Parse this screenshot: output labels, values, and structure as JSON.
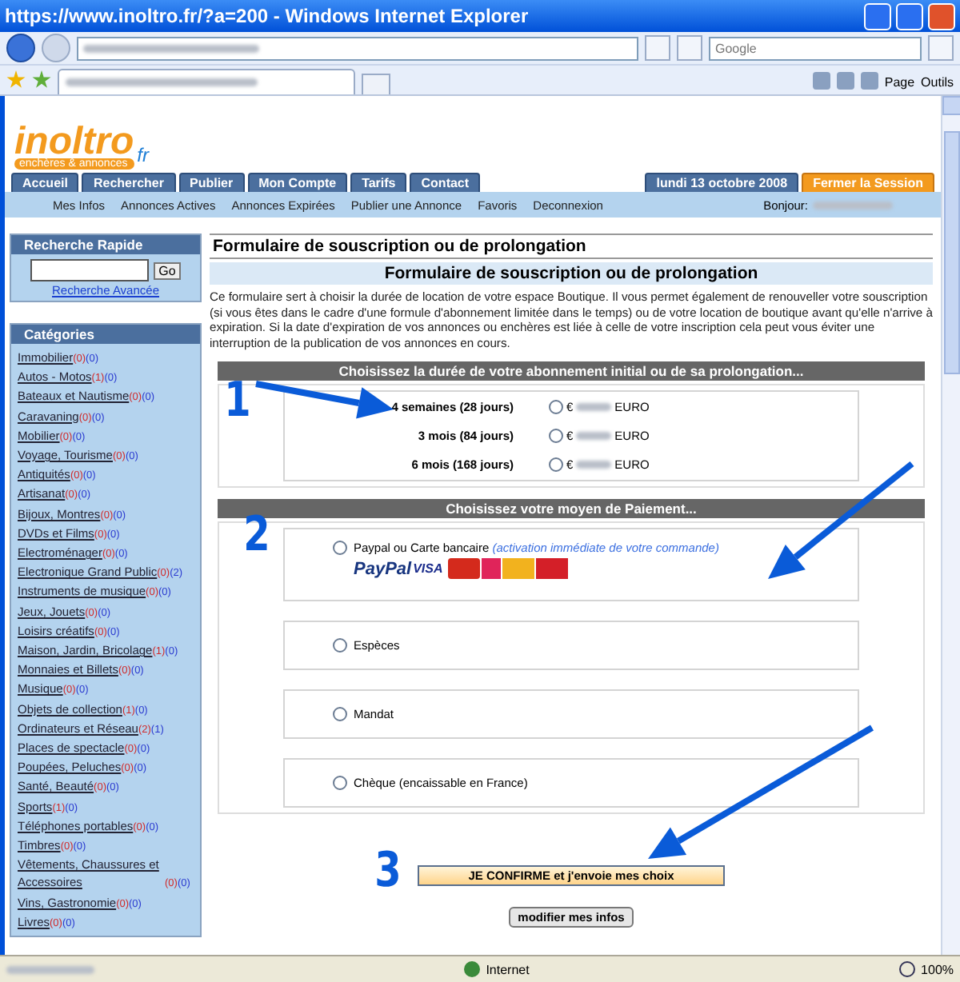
{
  "browser": {
    "title": "https://www.inoltro.fr/?a=200 - Windows Internet Explorer",
    "search_placeholder": "Google",
    "toolbar_menus": [
      "Page",
      "Outils"
    ],
    "status_zone": "Internet",
    "zoom": "100%"
  },
  "logo": {
    "name": "inoltro",
    "tagline": "enchères & annonces",
    "suffix": "fr"
  },
  "nav": {
    "tabs": [
      {
        "label": "Accueil"
      },
      {
        "label": "Rechercher"
      },
      {
        "label": "Publier"
      },
      {
        "label": "Mon Compte"
      },
      {
        "label": "Tarifs"
      },
      {
        "label": "Contact"
      }
    ],
    "date": "lundi 13 octobre 2008",
    "logout": "Fermer la Session"
  },
  "subnav": {
    "links": [
      "Mes Infos",
      "Annonces Actives",
      "Annonces Expirées",
      "Publier une Annonce",
      "Favoris",
      "Deconnexion"
    ],
    "greeting": "Bonjour:"
  },
  "quick_search": {
    "title": "Recherche Rapide",
    "button": "Go",
    "advanced_link": "Recherche Avancée"
  },
  "categories": {
    "title": "Catégories",
    "items": [
      {
        "name": "Immobilier",
        "count_1": "(0)",
        "count_2": "(0)"
      },
      {
        "name": "Autos - Motos",
        "count_1": "(1)",
        "count_2": "(0)"
      },
      {
        "name": "Bateaux et Nautisme",
        "count_1": "(0)",
        "count_2": "(0)"
      },
      {
        "name": "Caravaning",
        "count_1": "(0)",
        "count_2": "(0)"
      },
      {
        "name": "Mobilier",
        "count_1": "(0)",
        "count_2": "(0)"
      },
      {
        "name": "Voyage, Tourisme",
        "count_1": "(0)",
        "count_2": "(0)"
      },
      {
        "name": "Antiquités",
        "count_1": "(0)",
        "count_2": "(0)"
      },
      {
        "name": "Artisanat",
        "count_1": "(0)",
        "count_2": "(0)"
      },
      {
        "name": "Bijoux, Montres",
        "count_1": "(0)",
        "count_2": "(0)"
      },
      {
        "name": "DVDs et Films",
        "count_1": "(0)",
        "count_2": "(0)"
      },
      {
        "name": "Electroménager",
        "count_1": "(0)",
        "count_2": "(0)"
      },
      {
        "name": "Electronique Grand Public",
        "count_1": "(0)",
        "count_2": "(2)"
      },
      {
        "name": "Instruments de musique",
        "count_1": "(0)",
        "count_2": "(0)"
      },
      {
        "name": "Jeux, Jouets",
        "count_1": "(0)",
        "count_2": "(0)"
      },
      {
        "name": "Loisirs créatifs",
        "count_1": "(0)",
        "count_2": "(0)"
      },
      {
        "name": "Maison, Jardin, Bricolage",
        "count_1": "(1)",
        "count_2": "(0)"
      },
      {
        "name": "Monnaies et Billets",
        "count_1": "(0)",
        "count_2": "(0)"
      },
      {
        "name": "Musique",
        "count_1": "(0)",
        "count_2": "(0)"
      },
      {
        "name": "Objets de collection",
        "count_1": "(1)",
        "count_2": "(0)"
      },
      {
        "name": "Ordinateurs et Réseau",
        "count_1": "(2)",
        "count_2": "(1)"
      },
      {
        "name": "Places de spectacle",
        "count_1": "(0)",
        "count_2": "(0)"
      },
      {
        "name": "Poupées, Peluches",
        "count_1": "(0)",
        "count_2": "(0)"
      },
      {
        "name": "Santé, Beauté",
        "count_1": "(0)",
        "count_2": "(0)"
      },
      {
        "name": "Sports",
        "count_1": "(1)",
        "count_2": "(0)"
      },
      {
        "name": "Téléphones portables",
        "count_1": "(0)",
        "count_2": "(0)"
      },
      {
        "name": "Timbres",
        "count_1": "(0)",
        "count_2": "(0)"
      },
      {
        "name": "Vêtements, Chaussures et Accessoires",
        "count_1": "(0)",
        "count_2": "(0)"
      },
      {
        "name": "Vins, Gastronomie",
        "count_1": "(0)",
        "count_2": "(0)"
      },
      {
        "name": "Livres",
        "count_1": "(0)",
        "count_2": "(0)"
      }
    ]
  },
  "form": {
    "title": "Formulaire de souscription ou de prolongation",
    "subtitle": "Formulaire de souscription ou de prolongation",
    "description": "Ce formulaire sert à choisir la durée de location de votre espace Boutique. Il vous permet également de renouveller votre souscription (si vous êtes dans le cadre d'une formule d'abonnement limitée dans le temps) ou de votre location de boutique avant qu'elle n'arrive à expiration. Si la date d'expiration de vos annonces ou enchères est liée à celle de votre inscription cela peut vous éviter une interruption de la publication de vos annonces en cours.",
    "duration": {
      "header": "Choisissez la durée de votre abonnement initial ou de sa prolongation...",
      "options": [
        {
          "label": "4 semaines (28 jours)",
          "currency_symbol": "€",
          "currency": "EURO",
          "selected": false
        },
        {
          "label": "3 mois (84 jours)",
          "currency_symbol": "€",
          "currency": "EURO",
          "selected": false
        },
        {
          "label": "6 mois (168 jours)",
          "currency_symbol": "€",
          "currency": "EURO",
          "selected": false
        }
      ]
    },
    "payment": {
      "header": "Choisissez votre moyen de Paiement...",
      "methods": [
        {
          "label": "Paypal ou Carte bancaire",
          "note": "(activation immédiate de votre commande)",
          "selected": false,
          "logos": [
            {
              "kind": "paypal",
              "text": "PayPal"
            },
            {
              "kind": "visa",
              "text": "VISA"
            },
            {
              "kind": "mastercard"
            },
            {
              "kind": "card"
            },
            {
              "kind": "cb"
            },
            {
              "kind": "card4"
            }
          ]
        },
        {
          "label": "Espèces",
          "selected": false
        },
        {
          "label": "Mandat",
          "selected": false
        },
        {
          "label": "Chèque (encaissable en France)",
          "selected": false
        }
      ]
    },
    "confirm_button": "JE CONFIRME et j'envoie mes choix",
    "modify_button": "modifier mes infos"
  },
  "annotations": [
    {
      "number": "1"
    },
    {
      "number": "2"
    },
    {
      "number": "3"
    }
  ]
}
